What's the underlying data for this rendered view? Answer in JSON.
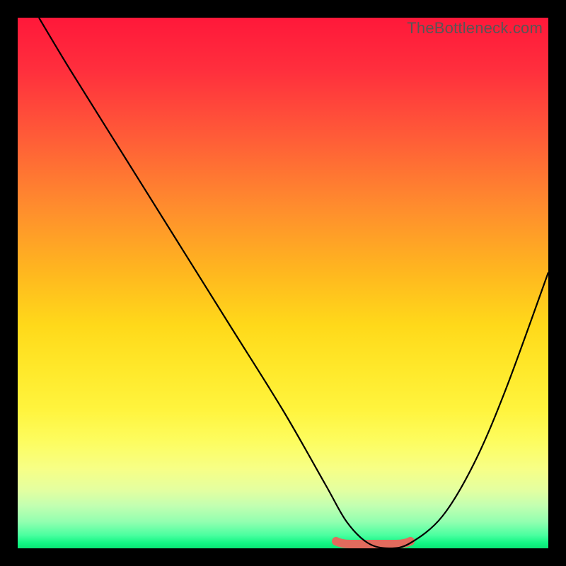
{
  "watermark": "TheBottleneck.com",
  "chart_data": {
    "type": "line",
    "title": "",
    "xlabel": "",
    "ylabel": "",
    "xlim": [
      0,
      100
    ],
    "ylim": [
      0,
      100
    ],
    "grid": false,
    "legend": false,
    "series": [
      {
        "name": "bottleneck-curve",
        "x": [
          4,
          10,
          20,
          30,
          40,
          50,
          58,
          62,
          66,
          70,
          74,
          80,
          86,
          92,
          100
        ],
        "y": [
          100,
          90,
          74,
          58,
          42,
          26,
          12,
          5,
          1,
          0,
          1,
          6,
          16,
          30,
          52
        ]
      }
    ],
    "annotations": [
      {
        "name": "valley-highlight",
        "x_from": 60,
        "x_to": 74,
        "y": 0,
        "color": "#e26b5d"
      }
    ],
    "background_gradient": {
      "top": "#ff183a",
      "mid": "#ffe82a",
      "bottom": "#0be574"
    }
  }
}
